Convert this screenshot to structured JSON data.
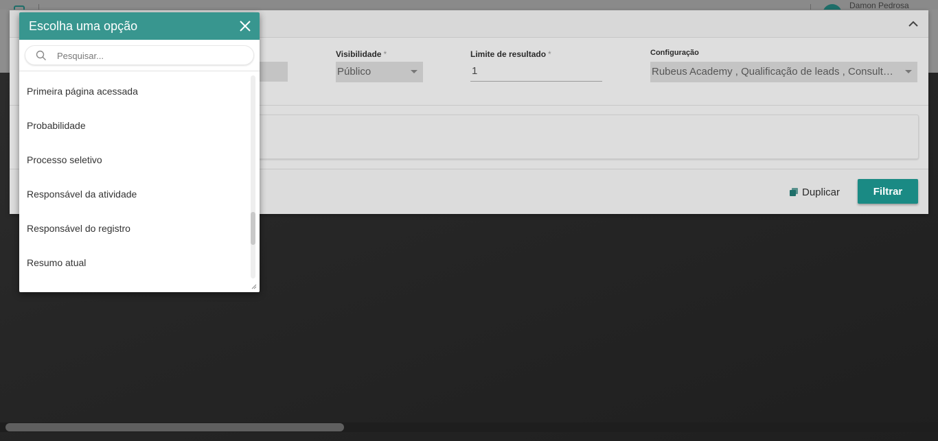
{
  "topbar": {
    "user_name": "Damon Pedrosa"
  },
  "filter_panel": {
    "visibility": {
      "label": "Visibilidade",
      "required_mark": "*",
      "value": "Público"
    },
    "result_limit": {
      "label": "Limite de resultado",
      "required_mark": "*",
      "value": "1"
    },
    "configuration": {
      "label": "Configuração",
      "value": "Rubeus Academy , Qualificação de leads , Consultori..."
    },
    "footer": {
      "duplicate_label": "Duplicar",
      "filter_label": "Filtrar"
    }
  },
  "popup": {
    "title": "Escolha uma opção",
    "search_placeholder": "Pesquisar...",
    "options": [
      "Primeira página acessada",
      "Probabilidade",
      "Processo seletivo",
      "Responsável da atividade",
      "Responsável do registro",
      "Resumo atual"
    ]
  },
  "colors": {
    "accent": "#1a8a84",
    "popup_header": "#38968f"
  },
  "icons": [
    "close-icon",
    "search-icon",
    "chevron-up-icon",
    "duplicate-icon",
    "caret-down-icon",
    "resize-handle-icon"
  ]
}
